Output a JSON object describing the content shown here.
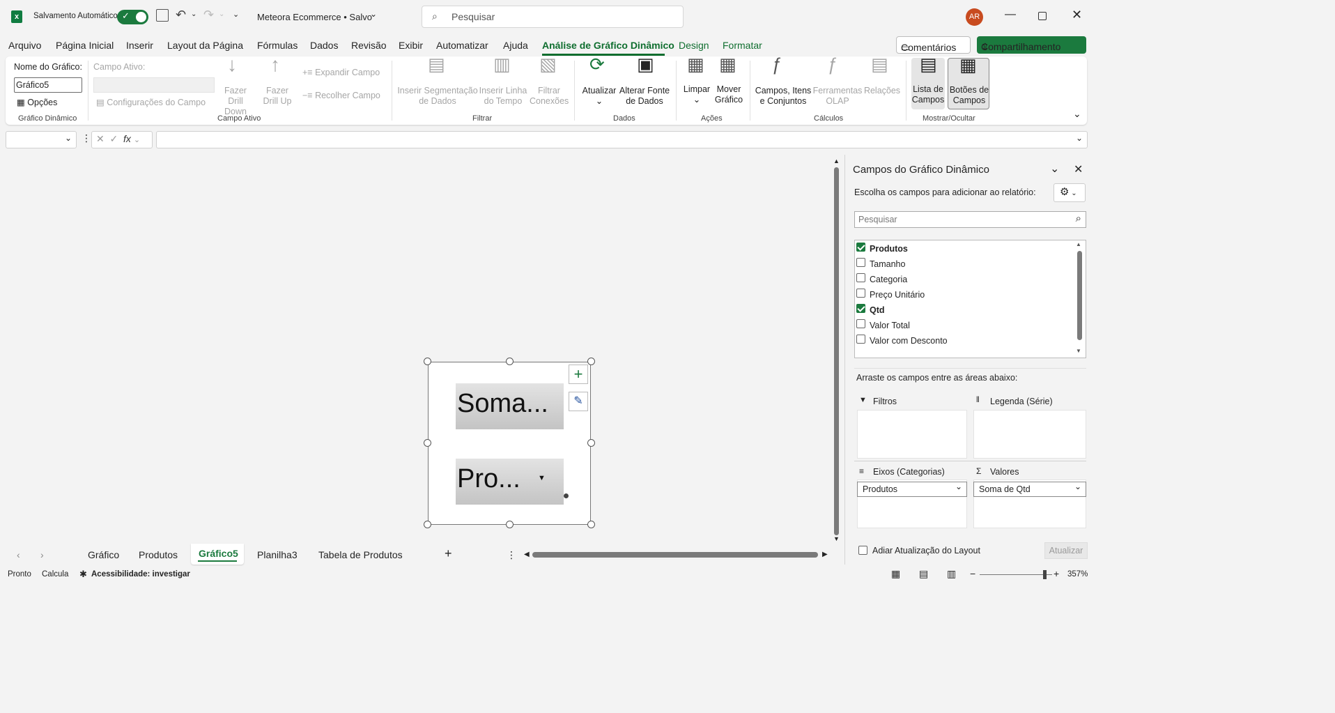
{
  "titlebar": {
    "autosave_label": "Salvamento Automático",
    "doc_title": "Meteora Ecommerce • Salvo",
    "search_placeholder": "Pesquisar",
    "avatar": "AR"
  },
  "menu": [
    "Arquivo",
    "Página Inicial",
    "Inserir",
    "Layout da Página",
    "Fórmulas",
    "Dados",
    "Revisão",
    "Exibir",
    "Automatizar",
    "Ajuda",
    "Análise de Gráfico Dinâmico",
    "Design",
    "Formatar"
  ],
  "menu_active": "Análise de Gráfico Dinâmico",
  "comments_label": "Comentários",
  "share_label": "Compartilhamento",
  "ribbon": {
    "chart_name_label": "Nome do Gráfico:",
    "chart_name_value": "Gráfico5",
    "options": "Opções",
    "group1": "Gráfico Dinâmico",
    "active_field_label": "Campo Ativo:",
    "field_settings": "Configurações do Campo",
    "drill_down": "Fazer Drill Down",
    "drill_up": "Fazer Drill Up",
    "expand": "Expandir Campo",
    "collapse": "Recolher Campo",
    "group2": "Campo Ativo",
    "slicer": "Inserir Segmentação de Dados",
    "timeline": "Inserir Linha do Tempo",
    "filter_conn": "Filtrar Conexões",
    "group3": "Filtrar",
    "refresh": "Atualizar",
    "change_source": "Alterar Fonte de Dados",
    "group4": "Dados",
    "clear": "Limpar",
    "move": "Mover Gráfico",
    "group5": "Ações",
    "fields_items": "Campos, Itens e Conjuntos",
    "olap": "Ferramentas OLAP",
    "relations": "Relações",
    "group6": "Cálculos",
    "field_list": "Lista de Campos",
    "field_buttons": "Botões de Campos",
    "group7": "Mostrar/Ocultar"
  },
  "chart": {
    "value_button": "Soma...",
    "axis_button": "Pro..."
  },
  "pane": {
    "title": "Campos do Gráfico Dinâmico",
    "subtitle": "Escolha os campos para adicionar ao relatório:",
    "search_placeholder": "Pesquisar",
    "fields": [
      {
        "name": "Produtos",
        "checked": true
      },
      {
        "name": "Tamanho",
        "checked": false
      },
      {
        "name": "Categoria",
        "checked": false
      },
      {
        "name": "Preço Unitário",
        "checked": false
      },
      {
        "name": "Qtd",
        "checked": true
      },
      {
        "name": "Valor Total",
        "checked": false
      },
      {
        "name": "Valor com Desconto",
        "checked": false
      }
    ],
    "drag_label": "Arraste os campos entre as áreas abaixo:",
    "filters": "Filtros",
    "legend": "Legenda (Série)",
    "axis": "Eixos (Categorias)",
    "values": "Valores",
    "axis_value": "Produtos",
    "values_value": "Soma de Qtd",
    "defer": "Adiar Atualização do Layout",
    "update": "Atualizar"
  },
  "tabs": [
    "Gráfico",
    "Produtos",
    "Gráfico5",
    "Planilha3",
    "Tabela de Produtos"
  ],
  "active_tab": "Gráfico5",
  "status": {
    "ready": "Pronto",
    "calc": "Calcula",
    "accessibility": "Acessibilidade: investigar",
    "zoom": "357%"
  },
  "colors": {
    "accent": "#1b7a3e",
    "active_menu": "#0f6e2f"
  }
}
